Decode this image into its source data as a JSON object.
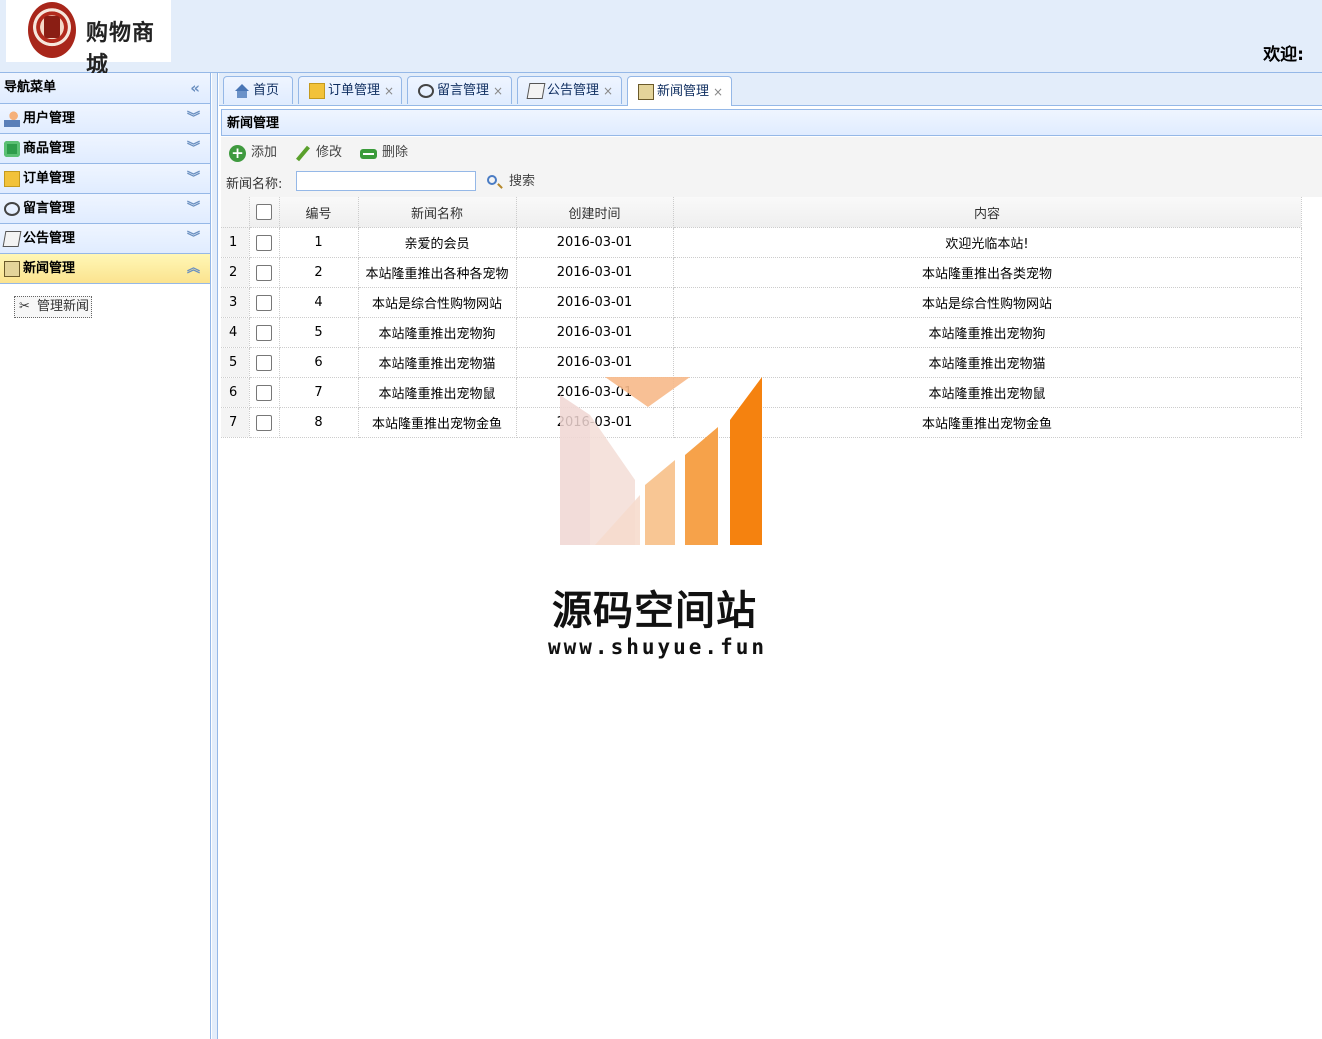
{
  "header": {
    "logo_text": "购物商城",
    "welcome": "欢迎:"
  },
  "sidebar": {
    "title": "导航菜单",
    "items": [
      {
        "label": "用户管理",
        "icon": "user-icon"
      },
      {
        "label": "商品管理",
        "icon": "goods-icon"
      },
      {
        "label": "订单管理",
        "icon": "order-icon"
      },
      {
        "label": "留言管理",
        "icon": "message-icon"
      },
      {
        "label": "公告管理",
        "icon": "notice-icon"
      },
      {
        "label": "新闻管理",
        "icon": "news-icon",
        "expanded": true
      }
    ],
    "sub_items": [
      {
        "label": "管理新闻",
        "icon": "tools-icon"
      }
    ]
  },
  "tabs": [
    {
      "label": "首页",
      "icon": "home-icon",
      "closable": false
    },
    {
      "label": "订单管理",
      "icon": "order-icon",
      "closable": true
    },
    {
      "label": "留言管理",
      "icon": "message-icon",
      "closable": true
    },
    {
      "label": "公告管理",
      "icon": "notice-icon",
      "closable": true
    },
    {
      "label": "新闻管理",
      "icon": "news-icon",
      "closable": true,
      "active": true
    }
  ],
  "tab_close_glyph": "×",
  "panel": {
    "title": "新闻管理",
    "toolbar": {
      "add_label": "添加",
      "edit_label": "修改",
      "delete_label": "删除"
    },
    "search": {
      "label": "新闻名称:",
      "value": "",
      "button_label": "搜索"
    }
  },
  "grid": {
    "columns": [
      "编号",
      "新闻名称",
      "创建时间",
      "内容"
    ],
    "rows": [
      {
        "rownum": "1",
        "id": "1",
        "name": "亲爱的会员",
        "created": "2016-03-01",
        "content": "欢迎光临本站!"
      },
      {
        "rownum": "2",
        "id": "2",
        "name": "本站隆重推出各种各宠物",
        "created": "2016-03-01",
        "content": "本站隆重推出各类宠物"
      },
      {
        "rownum": "3",
        "id": "4",
        "name": "本站是综合性购物网站",
        "created": "2016-03-01",
        "content": "本站是综合性购物网站"
      },
      {
        "rownum": "4",
        "id": "5",
        "name": "本站隆重推出宠物狗",
        "created": "2016-03-01",
        "content": "本站隆重推出宠物狗"
      },
      {
        "rownum": "5",
        "id": "6",
        "name": "本站隆重推出宠物猫",
        "created": "2016-03-01",
        "content": "本站隆重推出宠物猫"
      },
      {
        "rownum": "6",
        "id": "7",
        "name": "本站隆重推出宠物鼠",
        "created": "2016-03-01",
        "content": "本站隆重推出宠物鼠"
      },
      {
        "rownum": "7",
        "id": "8",
        "name": "本站隆重推出宠物金鱼",
        "created": "2016-03-01",
        "content": "本站隆重推出宠物金鱼"
      }
    ]
  },
  "watermark": {
    "title": "源码空间站",
    "url": "www.shuyue.fun"
  },
  "colors": {
    "header_bg": "#e3edfa",
    "border": "#95b8e7",
    "active_nav": "#fbe38f",
    "watermark_orange": "#f5820f"
  }
}
